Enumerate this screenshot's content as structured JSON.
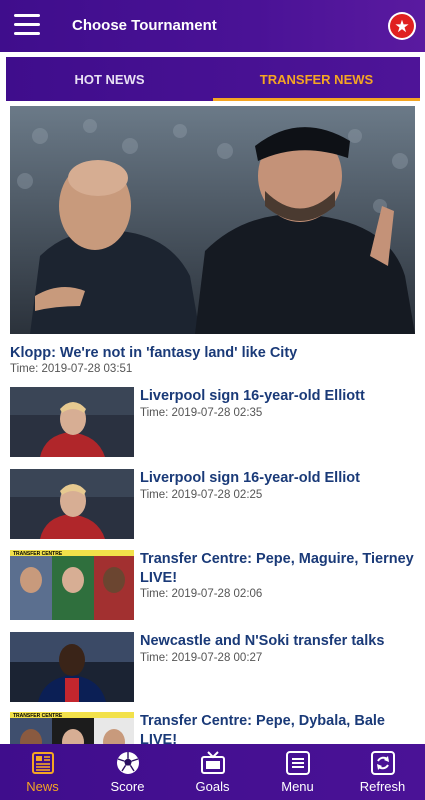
{
  "header": {
    "title": "Choose Tournament",
    "menu_icon": "hamburger-menu-icon",
    "star_icon": "star-icon"
  },
  "tabs": [
    {
      "label": "HOT NEWS",
      "active": false
    },
    {
      "label": "TRANSFER NEWS",
      "active": true
    }
  ],
  "featured": {
    "title": "Klopp: We're not in 'fantasy land' like City",
    "time": "Time: 2019-07-28 03:51"
  },
  "items": [
    {
      "title": "Liverpool sign 16-year-old Elliott",
      "time": "Time: 2019-07-28 02:35"
    },
    {
      "title": "Liverpool sign 16-year-old Elliot",
      "time": "Time: 2019-07-28 02:25"
    },
    {
      "title": "Transfer Centre: Pepe, Maguire, Tierney LIVE!",
      "time": "Time: 2019-07-28 02:06",
      "thumb_caption": "TRANSFER CENTRE"
    },
    {
      "title": "Newcastle and N'Soki transfer talks",
      "time": "Time: 2019-07-28 00:27"
    },
    {
      "title": "Transfer Centre: Pepe, Dybala, Bale LIVE!",
      "time": "",
      "thumb_caption": "TRANSFER CENTRE"
    }
  ],
  "bottom_nav": [
    {
      "label": "News",
      "icon": "newspaper-icon",
      "active": true
    },
    {
      "label": "Score",
      "icon": "soccer-ball-icon",
      "active": false
    },
    {
      "label": "Goals",
      "icon": "tv-icon",
      "active": false
    },
    {
      "label": "Menu",
      "icon": "list-menu-icon",
      "active": false
    },
    {
      "label": "Refresh",
      "icon": "refresh-icon",
      "active": false
    }
  ],
  "colors": {
    "primary": "#45108f",
    "accent": "#f5a623",
    "headline": "#1a3a78",
    "star": "#e02020"
  }
}
